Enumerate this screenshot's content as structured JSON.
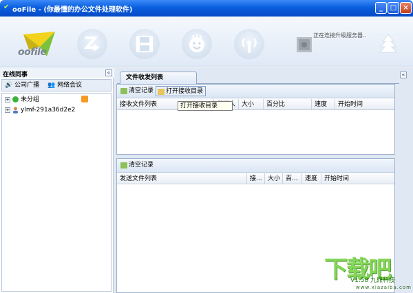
{
  "window": {
    "title": "ooFile - (你最懂的办公文件处理软件)",
    "min_label": "_",
    "max_label": "□",
    "close_label": "×"
  },
  "banner": {
    "logo_text": "oofile",
    "status": "正在连接升级服务器..",
    "tools": [
      "zip-transfer-icon",
      "save-icon",
      "smiley-icon",
      "broadcast-icon",
      "safe-icon",
      "tree-icon"
    ]
  },
  "left": {
    "title": "在线同事",
    "collapse": "«",
    "tabs": [
      {
        "label": "公司广播",
        "icon": "broadcast-icon"
      },
      {
        "label": "网络会议",
        "icon": "meeting-icon"
      }
    ],
    "groups": [
      {
        "name": "未分组",
        "expander": "+",
        "icon": "online-status-icon"
      },
      {
        "name": "ylmf-291a36d2e2",
        "expander": "+",
        "icon": "user-icon"
      }
    ]
  },
  "right": {
    "tab": "文件收发列表",
    "collapse": "«",
    "receive": {
      "buttons": [
        "清空记录",
        "打开接收目录"
      ],
      "columns": [
        "接收文件列表",
        "发送人",
        "大小",
        "百分比",
        "速度",
        "开始时间"
      ],
      "tooltip": "打开接收目录"
    },
    "send": {
      "buttons": [
        "清空记录"
      ],
      "columns": [
        "发送文件列表",
        "接...",
        "大小",
        "百...",
        "速度",
        "开始时间"
      ]
    }
  },
  "watermark": {
    "big": "下载吧",
    "version": "V1.58 九鼎科技",
    "url": "www.xiazaiba.com"
  },
  "colors": {
    "title_blue": "#0a5fe0",
    "panel_bg": "#dfe8f3",
    "watermark_green": "#6ecf3a"
  }
}
